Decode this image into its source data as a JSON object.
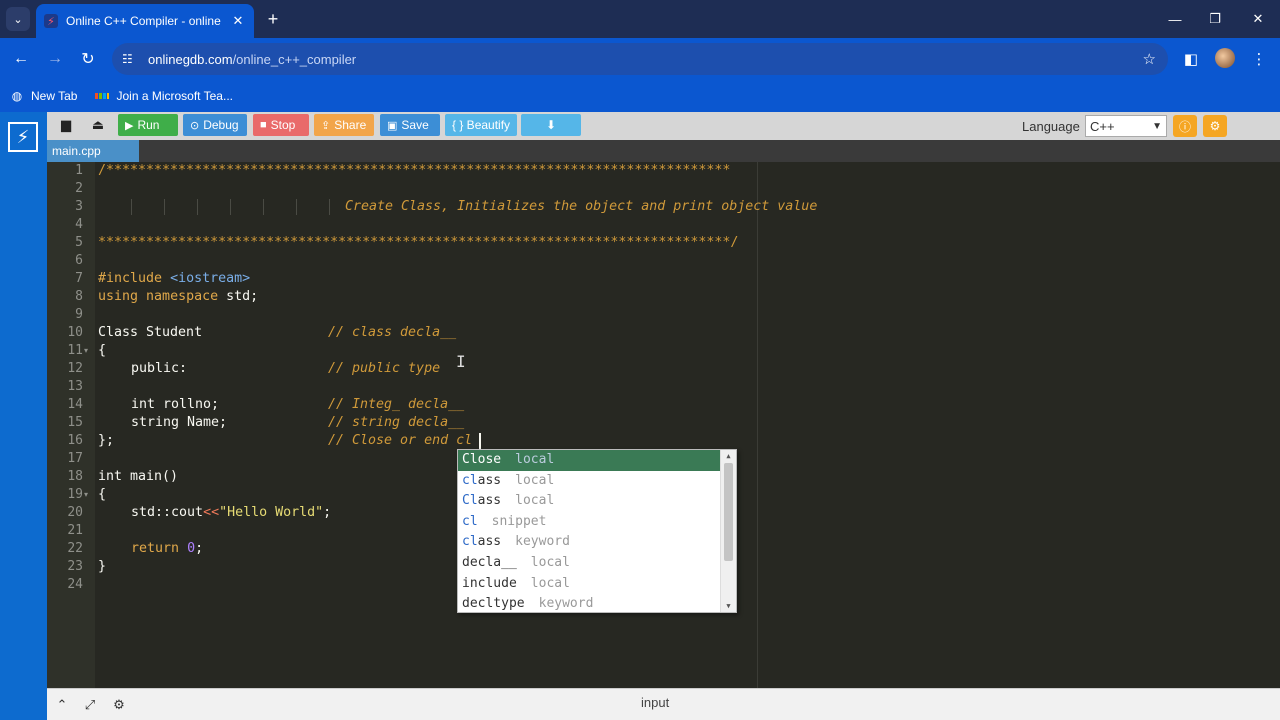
{
  "browser": {
    "tab_title": "Online C++ Compiler - online e",
    "tab_close": "✕",
    "new_tab": "+",
    "url_host": "onlinegdb.com",
    "url_path": "/online_c++_compiler",
    "bookmarks": [
      {
        "label": "New Tab",
        "icon": "globe-icon"
      },
      {
        "label": "Join a Microsoft Tea...",
        "icon": "microsoft-logo"
      }
    ],
    "ms_colors": [
      "#f25022",
      "#7fba00",
      "#00a4ef",
      "#ffb900"
    ]
  },
  "toolbar": {
    "run": "Run",
    "debug": "Debug",
    "stop": "Stop",
    "share": "Share",
    "save": "Save",
    "beautify": "{ } Beautify",
    "language_label": "Language",
    "language_value": "C++",
    "colors": {
      "run": "#3fae49",
      "debug": "#3c8ed6",
      "stop": "#e96a6a",
      "share": "#f2a54a",
      "save": "#3c8ed6",
      "beautify": "#55b6e8",
      "download": "#55b6e8"
    }
  },
  "file_tab": "main.cpp",
  "editor": {
    "line_numbers": [
      "1",
      "2",
      "3",
      "4",
      "5",
      "6",
      "7",
      "8",
      "9",
      "10",
      "11",
      "12",
      "13",
      "14",
      "15",
      "16",
      "17",
      "18",
      "19",
      "20",
      "21",
      "22",
      "23",
      "24"
    ],
    "lines": {
      "l1": "/******************************************************************************",
      "l3": "Create Class, Initializes the object and print object value",
      "l5": "*******************************************************************************/",
      "l7_pp": "#include",
      "l7_inc": "<iostream>",
      "l8_kw1": "using",
      "l8_kw2": "namespace",
      "l8_rest": "std;",
      "l10_code": "Class Student",
      "l10_cm": "// class decla__",
      "l11": "{",
      "l12_code": "public:",
      "l12_cm": "// public type",
      "l14_code": "int rollno;",
      "l14_cm": "// Integ_ decla__",
      "l15_code": "string Name;",
      "l15_cm": "// string decla__",
      "l16_code": "};",
      "l16_cm": "// Close or end cl",
      "l18": "int main()",
      "l19": "{",
      "l20_a": "std::cout",
      "l20_op": "<<",
      "l20_str": "\"Hello World\"",
      "l20_end": ";",
      "l22_kw": "return",
      "l22_num": "0",
      "l22_end": ";",
      "l23": "}"
    }
  },
  "autocomplete": [
    {
      "match": "Cl",
      "rest": "ose",
      "meta": "local"
    },
    {
      "match": "cl",
      "rest": "ass",
      "meta": "local"
    },
    {
      "match": "Cl",
      "rest": "ass",
      "meta": "local"
    },
    {
      "match": "cl",
      "rest": "",
      "meta": "snippet"
    },
    {
      "match": "cl",
      "rest": "ass",
      "meta": "keyword"
    },
    {
      "match": "",
      "rest": "decla__",
      "meta": "local"
    },
    {
      "match": "",
      "rest": "include",
      "meta": "local"
    },
    {
      "match": "",
      "rest": "decltype",
      "meta": "keyword"
    }
  ],
  "bottom": {
    "input_label": "input"
  }
}
